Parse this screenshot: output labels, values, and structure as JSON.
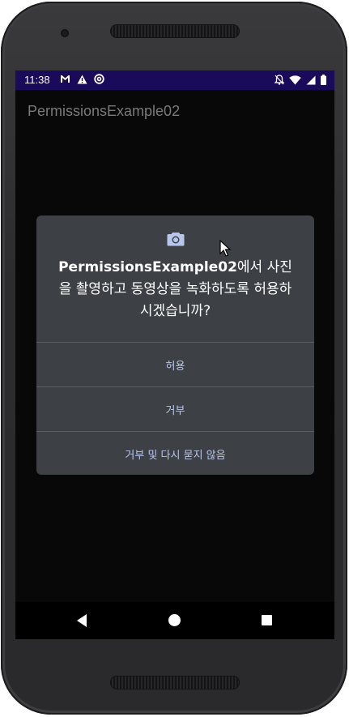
{
  "status_bar": {
    "time": "11:38",
    "icons_left": [
      "gmail-icon",
      "warning-icon",
      "sync-icon"
    ],
    "icons_right": [
      "notifications-off-icon",
      "wifi-icon",
      "signal-icon",
      "battery-icon"
    ]
  },
  "app": {
    "title": "PermissionsExample02"
  },
  "dialog": {
    "icon": "camera-icon",
    "app_name": "PermissionsExample02",
    "message": "에서 사진을 촬영하고 동영상을 녹화하도록 허용하시겠습니까?",
    "buttons": {
      "allow": "허용",
      "deny": "거부",
      "deny_dont_ask": "거부 및 다시 묻지 않음"
    }
  },
  "nav_bar": {
    "items": [
      "back",
      "home",
      "recents"
    ]
  },
  "colors": {
    "status_bar_bg": "#1a0a5a",
    "dialog_bg": "#3d4044",
    "button_text": "#b8c6ec",
    "screen_bg": "#080808"
  }
}
